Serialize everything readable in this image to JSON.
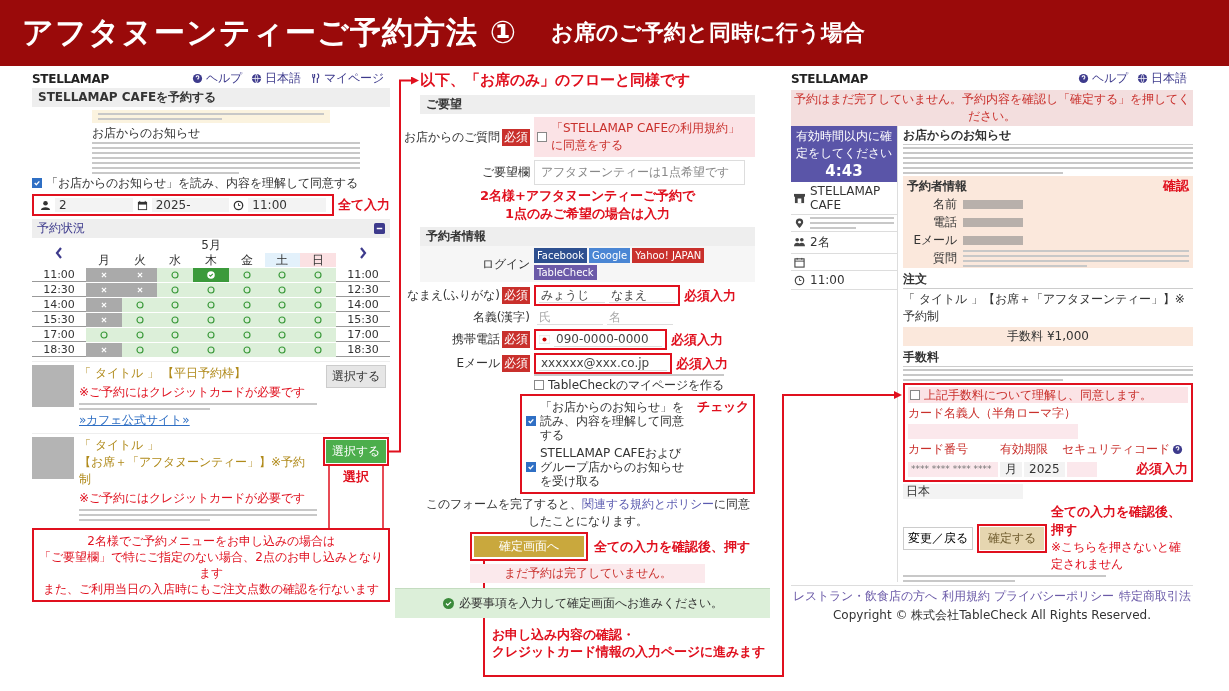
{
  "header": {
    "title": "アフタヌーンティーご予約方法 ①",
    "subtitle": "お席のご予約と同時に行う場合"
  },
  "left": {
    "logo": "STELLAMAP",
    "nav": [
      "ヘルプ",
      "日本語",
      "マイページ"
    ],
    "page_title": "STELLAMAP CAFEを予約する",
    "notice_heading": "お店からのお知らせ",
    "agree": {
      "label": "「お店からのお知らせ」を読み、内容を理解して同意する",
      "checked": true
    },
    "selectors": {
      "people": "2",
      "date": "2025-",
      "time": "11:00"
    },
    "selectors_annotation": "全て入力",
    "availability": {
      "title": "予約状況",
      "month": "5月",
      "days": [
        {
          "label": "月",
          "kind": "weekday"
        },
        {
          "label": "火",
          "kind": "weekday"
        },
        {
          "label": "水",
          "kind": "weekday"
        },
        {
          "label": "木",
          "kind": "weekday"
        },
        {
          "label": "金",
          "kind": "weekday"
        },
        {
          "label": "土",
          "kind": "saturday"
        },
        {
          "label": "日",
          "kind": "sunday"
        }
      ],
      "rows": [
        {
          "time_left": "11:00",
          "time_right": "11:00",
          "slots": [
            {
              "available": false,
              "selected": false
            },
            {
              "available": false,
              "selected": false
            },
            {
              "available": true,
              "selected": false
            },
            {
              "available": true,
              "selected": true
            },
            {
              "available": true,
              "selected": false
            },
            {
              "available": true,
              "selected": false
            },
            {
              "available": true,
              "selected": false
            }
          ]
        },
        {
          "time_left": "12:30",
          "time_right": "12:30",
          "slots": [
            {
              "available": false,
              "selected": false
            },
            {
              "available": false,
              "selected": false
            },
            {
              "available": true,
              "selected": false
            },
            {
              "available": true,
              "selected": false
            },
            {
              "available": true,
              "selected": false
            },
            {
              "available": true,
              "selected": false
            },
            {
              "available": true,
              "selected": false
            }
          ]
        },
        {
          "time_left": "14:00",
          "time_right": "14:00",
          "slots": [
            {
              "available": false,
              "selected": false
            },
            {
              "available": true,
              "selected": false
            },
            {
              "available": true,
              "selected": false
            },
            {
              "available": true,
              "selected": false
            },
            {
              "available": true,
              "selected": false
            },
            {
              "available": true,
              "selected": false
            },
            {
              "available": true,
              "selected": false
            }
          ]
        },
        {
          "time_left": "15:30",
          "time_right": "15:30",
          "slots": [
            {
              "available": false,
              "selected": false
            },
            {
              "available": true,
              "selected": false
            },
            {
              "available": true,
              "selected": false
            },
            {
              "available": true,
              "selected": false
            },
            {
              "available": true,
              "selected": false
            },
            {
              "available": true,
              "selected": false
            },
            {
              "available": true,
              "selected": false
            }
          ]
        },
        {
          "time_left": "17:00",
          "time_right": "17:00",
          "slots": [
            {
              "available": true,
              "selected": false
            },
            {
              "available": true,
              "selected": false
            },
            {
              "available": true,
              "selected": false
            },
            {
              "available": true,
              "selected": false
            },
            {
              "available": true,
              "selected": false
            },
            {
              "available": true,
              "selected": false
            },
            {
              "available": true,
              "selected": false
            }
          ]
        },
        {
          "time_left": "18:30",
          "time_right": "18:30",
          "slots": [
            {
              "available": false,
              "selected": false
            },
            {
              "available": true,
              "selected": false
            },
            {
              "available": true,
              "selected": false
            },
            {
              "available": true,
              "selected": false
            },
            {
              "available": true,
              "selected": false
            },
            {
              "available": true,
              "selected": false
            },
            {
              "available": true,
              "selected": false
            }
          ]
        }
      ]
    },
    "menus": [
      {
        "title": "「 タイトル 」",
        "tag": "【平日予約枠】",
        "note": "※ご予約にはクレジットカードが必要です",
        "link": "»カフェ公式サイト»",
        "button": "選択する",
        "selected": false
      },
      {
        "title": "「 タイトル 」",
        "tag": "【お席＋「アフタヌーンティー」】※予約制",
        "note": "※ご予約にはクレジットカードが必要です",
        "button": "選択する",
        "selected": true
      }
    ],
    "select_annotation": "選択",
    "callout": [
      "2名様でご予約メニューをお申し込みの場合は",
      "「ご要望欄」で特にご指定のない場合、2点のお申し込みとなります",
      "また、ご利用当日の入店時にもご注文点数の確認を行ないます"
    ]
  },
  "middle": {
    "heading": "以下、「お席のみ」のフローと同様です",
    "request": {
      "title": "ご要望",
      "question_label": "お店からのご質問",
      "question_badge": "必須",
      "question_text": "「STELLAMAP CAFEの利用規約」に同意をする",
      "question_checked": false,
      "note_label": "ご要望欄",
      "note_value": "アフタヌーンティーは1点希望です",
      "annotation": [
        "2名様+アフタヌーンティーご予約で",
        "1点のみご希望の場合は入力"
      ]
    },
    "booker": {
      "title": "予約者情報",
      "login_label": "ログイン",
      "logins": [
        {
          "label": "Facebook",
          "kind": "facebook"
        },
        {
          "label": "Google",
          "kind": "google"
        },
        {
          "label": "Yahoo! JAPAN",
          "kind": "yahoo"
        },
        {
          "label": "TableCheck",
          "kind": "tablecheck"
        }
      ],
      "fields": [
        {
          "label": "なまえ(ふりがな)",
          "badge": "必須",
          "kind": "name",
          "inputs": [
            {
              "value": "みょうじ"
            },
            {
              "value": "なまえ"
            }
          ],
          "annotation": "必須入力"
        },
        {
          "label": "名義(漢字)",
          "kind": "name",
          "inputs": [
            {
              "placeholder": "氏"
            },
            {
              "placeholder": "名"
            }
          ]
        },
        {
          "label": "携帯電話",
          "badge": "必須",
          "kind": "phone",
          "inputs": [
            {
              "value": "090-0000-0000"
            }
          ],
          "annotation": "必須入力"
        },
        {
          "label": "Eメール",
          "badge": "必須",
          "kind": "email",
          "inputs": [
            {
              "value": "xxxxxx@xxx.co.jp"
            }
          ],
          "annotation": "必須入力"
        }
      ],
      "mypage": {
        "label": "TableCheckのマイページを作る",
        "checked": false
      },
      "consents": [
        {
          "label": "「お店からのお知らせ」を読み、内容を理解して同意する",
          "checked": true
        },
        {
          "label": "STELLAMAP CAFEおよびグループ店からのお知らせを受け取る",
          "checked": true
        }
      ],
      "consent_annotation": "チェック",
      "policy_before": "このフォームを完了すると、",
      "policy_link": "関連する規約とポリシー",
      "policy_after": "に同意したことになります。",
      "submit": "確定画面へ",
      "submit_annotation": "全ての入力を確認後、押す",
      "pending": "まだ予約は完了していません。",
      "status": "必要事項を入力して確定画面へお進みください。"
    },
    "next_annotation": [
      "お申し込み内容の確認・",
      "クレジットカード情報の入力ページに進みます"
    ]
  },
  "right": {
    "logo": "STELLAMAP",
    "nav": [
      "ヘルプ",
      "日本語"
    ],
    "banner": "予約はまだ完了していません。予約内容を確認し「確定する」を押してください。",
    "timer_label": "有効時間以内に確定をしてください",
    "timer": "4:43",
    "info": [
      {
        "kind": "shop",
        "text": "STELLAMAP CAFE"
      },
      {
        "kind": "address"
      },
      {
        "kind": "people",
        "text": "2名"
      },
      {
        "kind": "date"
      },
      {
        "kind": "time",
        "text": "11:00"
      }
    ],
    "notice_heading": "お店からのお知らせ",
    "booker": {
      "title": "予約者情報",
      "annotation": "確認",
      "rows": [
        {
          "label": "名前",
          "kind": "redacted"
        },
        {
          "label": "電話",
          "kind": "redacted"
        },
        {
          "label": "Eメール",
          "kind": "redacted"
        },
        {
          "label": "質問",
          "kind": "text"
        }
      ]
    },
    "order": {
      "title": "注文",
      "item": "「 タイトル 」【お席＋「アフタヌーンティー」】※予約制",
      "fee_total": "手数料 ¥1,000"
    },
    "fee": {
      "title": "手数料",
      "agree": {
        "label": "上記手数料について理解し、同意します。",
        "checked": false
      },
      "holder_label": "カード名義人（半角ローマ字）",
      "number_label": "カード番号",
      "expiry_label": "有効期限",
      "cvc_label": "セキュリティコード",
      "number_placeholder": "**** **** **** ****",
      "month": "月",
      "year": "2025",
      "annotation": "必須入力"
    },
    "country": "日本",
    "back": "変更／戻る",
    "confirm": "確定する",
    "confirm_annotation": "全ての入力を確認後、押す",
    "confirm_note": "※こちらを押さないと確定されません",
    "footer_links": [
      "レストラン・飲食店の方へ",
      "利用規約",
      "プライバシーポリシー",
      "特定商取引法"
    ],
    "copyright": "Copyright © 株式会社TableCheck All Rights Reserved."
  }
}
